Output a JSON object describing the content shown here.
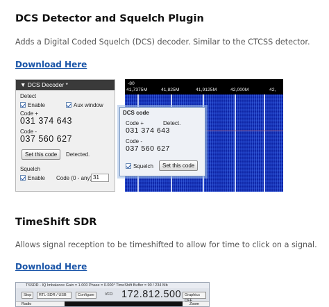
{
  "sections": [
    {
      "title": "DCS Detector and Squelch Plugin",
      "description": "Adds a Digital Coded Squelch (DCS) decoder. Similar to the CTCSS detector.",
      "link": "Download Here"
    },
    {
      "title": "TimeShift SDR",
      "description": "Allows signal reception to be timeshifted to allow for time to click on a signal.",
      "link": "Download Here"
    }
  ],
  "dcs_panel": {
    "title": "DCS Decoder *",
    "group_detect": "Detect",
    "enable": "Enable",
    "aux_window": "Aux window",
    "code_plus_label": "Code +",
    "code_plus": "031 374 643",
    "code_minus_label": "Code -",
    "code_minus": "037 560 627",
    "set_code": "Set this code",
    "detected": "Detected.",
    "group_squelch": "Squelch",
    "squelch_enable": "Enable",
    "code_any": "Code (0 - any)",
    "code_value": "31"
  },
  "spectrum": {
    "db_label": "-80",
    "ticks": [
      "41,7375M",
      "41,825M",
      "41,9125M",
      "42,000M",
      "42,"
    ],
    "colors": {
      "background": "#0d24a5",
      "lines": "#e8efff"
    }
  },
  "dcs_popup": {
    "title": "DCS code",
    "code_plus_label": "Code +",
    "detect": "Detect.",
    "code_plus": "031 374 643",
    "code_minus_label": "Code -",
    "code_minus": "037 560 627",
    "squelch": "Squelch",
    "set_code": "Set this code"
  },
  "timeshift": {
    "title": "TSSDR - IQ Imbalance Gain = 1.000 Phase = 0.000° TimeShift Buffer = 90 / 234 Mb",
    "stop": "Stop",
    "device": "RTL-SDR / USB",
    "configure": "Configure",
    "vfo": "VFO",
    "frequency": "172.812.500",
    "graphics": "Graphics OFF",
    "radio": "Radio",
    "zoom": "Zoom"
  },
  "colors": {
    "link": "#1a55a8",
    "heading": "#111111",
    "body_text": "#555555"
  }
}
